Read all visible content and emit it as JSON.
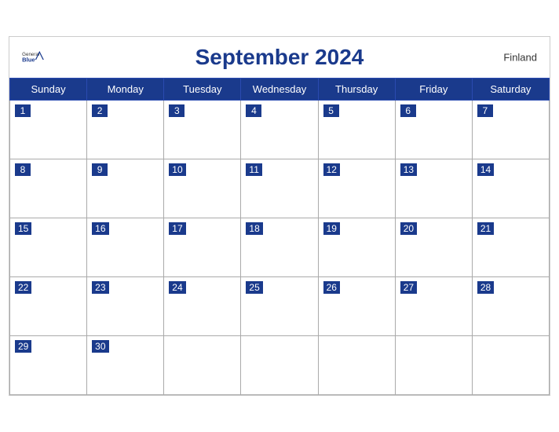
{
  "header": {
    "title": "September 2024",
    "country": "Finland",
    "brand_general": "General",
    "brand_blue": "Blue"
  },
  "days_of_week": [
    "Sunday",
    "Monday",
    "Tuesday",
    "Wednesday",
    "Thursday",
    "Friday",
    "Saturday"
  ],
  "weeks": [
    [
      {
        "date": 1,
        "active": true
      },
      {
        "date": 2,
        "active": true
      },
      {
        "date": 3,
        "active": true
      },
      {
        "date": 4,
        "active": true
      },
      {
        "date": 5,
        "active": true
      },
      {
        "date": 6,
        "active": true
      },
      {
        "date": 7,
        "active": true
      }
    ],
    [
      {
        "date": 8,
        "active": true
      },
      {
        "date": 9,
        "active": true
      },
      {
        "date": 10,
        "active": true
      },
      {
        "date": 11,
        "active": true
      },
      {
        "date": 12,
        "active": true
      },
      {
        "date": 13,
        "active": true
      },
      {
        "date": 14,
        "active": true
      }
    ],
    [
      {
        "date": 15,
        "active": true
      },
      {
        "date": 16,
        "active": true
      },
      {
        "date": 17,
        "active": true
      },
      {
        "date": 18,
        "active": true
      },
      {
        "date": 19,
        "active": true
      },
      {
        "date": 20,
        "active": true
      },
      {
        "date": 21,
        "active": true
      }
    ],
    [
      {
        "date": 22,
        "active": true
      },
      {
        "date": 23,
        "active": true
      },
      {
        "date": 24,
        "active": true
      },
      {
        "date": 25,
        "active": true
      },
      {
        "date": 26,
        "active": true
      },
      {
        "date": 27,
        "active": true
      },
      {
        "date": 28,
        "active": true
      }
    ],
    [
      {
        "date": 29,
        "active": true
      },
      {
        "date": 30,
        "active": true
      },
      {
        "date": null,
        "active": false
      },
      {
        "date": null,
        "active": false
      },
      {
        "date": null,
        "active": false
      },
      {
        "date": null,
        "active": false
      },
      {
        "date": null,
        "active": false
      }
    ]
  ]
}
